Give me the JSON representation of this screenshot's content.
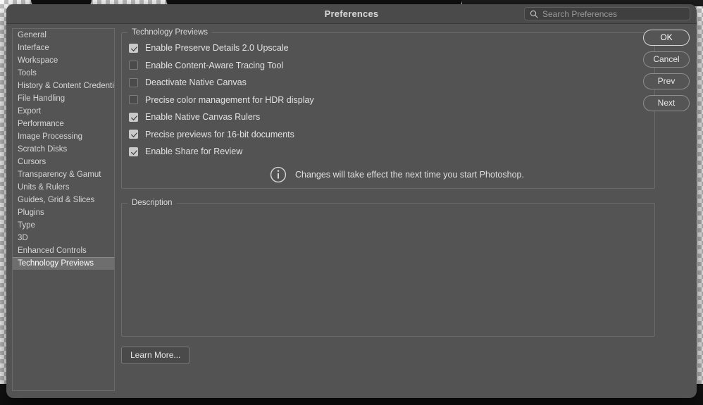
{
  "window": {
    "title": "Preferences"
  },
  "search": {
    "placeholder": "Search Preferences",
    "value": "",
    "icon": "search-icon"
  },
  "sidebar": {
    "items": [
      {
        "label": "General",
        "selected": false
      },
      {
        "label": "Interface",
        "selected": false
      },
      {
        "label": "Workspace",
        "selected": false
      },
      {
        "label": "Tools",
        "selected": false
      },
      {
        "label": "History & Content Credentials",
        "selected": false
      },
      {
        "label": "File Handling",
        "selected": false
      },
      {
        "label": "Export",
        "selected": false
      },
      {
        "label": "Performance",
        "selected": false
      },
      {
        "label": "Image Processing",
        "selected": false
      },
      {
        "label": "Scratch Disks",
        "selected": false
      },
      {
        "label": "Cursors",
        "selected": false
      },
      {
        "label": "Transparency & Gamut",
        "selected": false
      },
      {
        "label": "Units & Rulers",
        "selected": false
      },
      {
        "label": "Guides, Grid & Slices",
        "selected": false
      },
      {
        "label": "Plugins",
        "selected": false
      },
      {
        "label": "Type",
        "selected": false
      },
      {
        "label": "3D",
        "selected": false
      },
      {
        "label": "Enhanced Controls",
        "selected": false
      },
      {
        "label": "Technology Previews",
        "selected": true
      }
    ]
  },
  "technology_previews": {
    "legend": "Technology Previews",
    "options": [
      {
        "label": "Enable Preserve Details 2.0 Upscale",
        "checked": true
      },
      {
        "label": "Enable Content-Aware Tracing Tool",
        "checked": false
      },
      {
        "label": "Deactivate Native Canvas",
        "checked": false
      },
      {
        "label": "Precise color management for HDR display",
        "checked": false
      },
      {
        "label": "Enable Native Canvas Rulers",
        "checked": true
      },
      {
        "label": "Precise previews for 16-bit documents",
        "checked": true
      },
      {
        "label": "Enable Share for Review",
        "checked": true
      }
    ],
    "notice": {
      "icon": "info-icon",
      "text": "Changes will take effect the next time you start Photoshop."
    }
  },
  "description": {
    "legend": "Description",
    "body": ""
  },
  "learn_more": {
    "label": "Learn More..."
  },
  "buttons": [
    {
      "label": "OK",
      "primary": true
    },
    {
      "label": "Cancel",
      "primary": false
    },
    {
      "label": "Prev",
      "primary": false
    },
    {
      "label": "Next",
      "primary": false
    }
  ],
  "colors": {
    "dialog_background": "#535353",
    "titlebar": "#4a4a4a",
    "panel_border": "#6b6b6b",
    "selection": "#6e6e6e",
    "text": "#e2e2e2",
    "checkbox_on": "#c9c9c9"
  }
}
